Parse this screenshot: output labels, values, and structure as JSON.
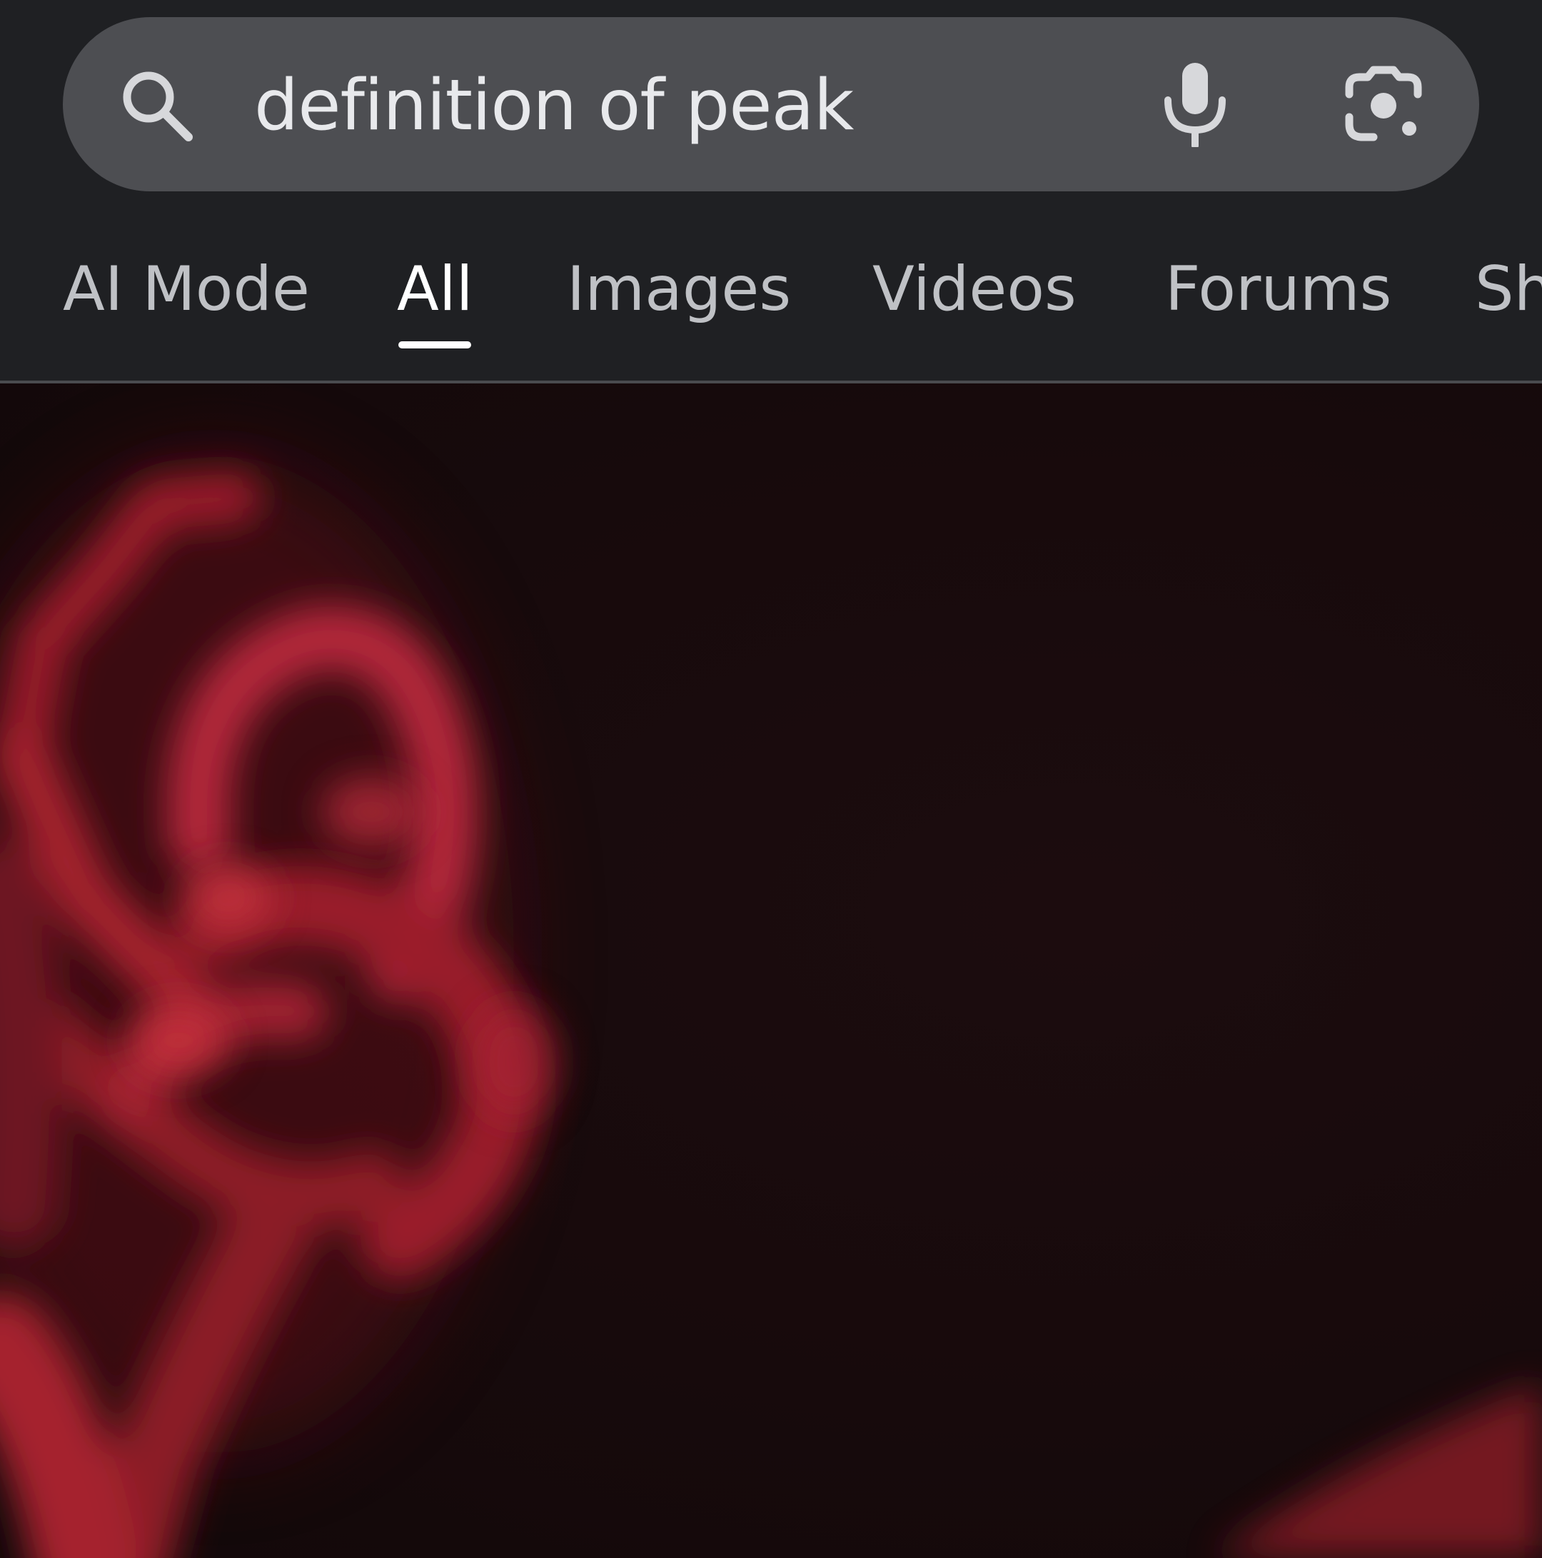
{
  "search": {
    "query": "definition of peak"
  },
  "tabs": [
    {
      "label": "AI Mode",
      "active": false
    },
    {
      "label": "All",
      "active": true
    },
    {
      "label": "Images",
      "active": false
    },
    {
      "label": "Videos",
      "active": false
    },
    {
      "label": "Forums",
      "active": false
    },
    {
      "label": "Sh",
      "active": false
    }
  ],
  "colors": {
    "background": "#1f2023",
    "search_bar": "#4d4e52",
    "tab_inactive": "#bfc1c5",
    "tab_active": "#ffffff",
    "media_background": "#170a0c",
    "media_figure": "#a8222f"
  },
  "icons": {
    "search": "search-icon",
    "voice": "microphone-icon",
    "lens": "camera-lens-icon"
  }
}
